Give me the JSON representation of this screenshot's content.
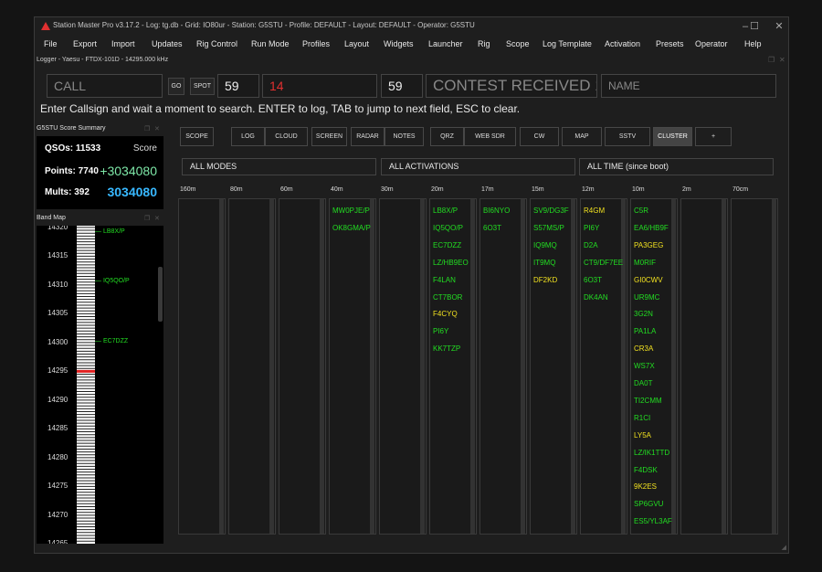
{
  "titlebar": {
    "title": "Station Master Pro v3.17.2 - Log: tg.db - Grid: IO80ur - Station: G5STU - Profile: DEFAULT - Layout: DEFAULT - Operator: G5STU",
    "logo_icon": "triangle-logo-icon",
    "minimize": "–",
    "maximize": "☐",
    "close": "✕"
  },
  "menu": [
    "File",
    "Export",
    "Import",
    "Updates",
    "Rig Control",
    "Run Mode",
    "Profiles",
    "Layout",
    "Widgets",
    "Launcher",
    "Rig",
    "Scope",
    "Log Template",
    "Activation",
    "Presets",
    "Operator",
    "Help"
  ],
  "logger": {
    "title": "Logger - Yaesu - FTDX-101D - 14295.000 kHz",
    "call_placeholder": "CALL",
    "go_label": "GO",
    "spot_label": "SPOT",
    "rst_sent": "59",
    "sent_serial": "14",
    "rst_rcvd": "59",
    "contest_placeholder": "CONTEST RECEIVED 1",
    "name_placeholder": "NAME",
    "hint": "Enter Callsign and wait a moment to search. ENTER to log, TAB to jump to next field, ESC to clear."
  },
  "score": {
    "header": "G5STU Score Summary",
    "qsos_label": "QSOs: 11533",
    "score_label": "Score",
    "points_label": "Points: 7740",
    "points_value": "+3034080",
    "mults_label": "Mults: 392",
    "mults_value": "3034080",
    "points_color": "#7ee8a8",
    "mults_color": "#38b8ff"
  },
  "bandmap": {
    "header": "Band Map",
    "freqs": [
      "14320",
      "14315",
      "14310",
      "14305",
      "14300",
      "14295",
      "14290",
      "14285",
      "14280",
      "14275",
      "14270",
      "14265"
    ],
    "spots": [
      {
        "label": "LB8X/P"
      },
      {
        "label": "IQ5QO/P"
      },
      {
        "label": "EC7DZZ"
      }
    ],
    "current_freq_color": "#e02020"
  },
  "cluster": {
    "tabs": [
      "SCOPE",
      "LOG",
      "CLOUD",
      "SCREEN",
      "RADAR",
      "NOTES",
      "QRZ",
      "WEB SDR",
      "CW",
      "MAP",
      "SSTV",
      "CLUSTER",
      "+"
    ],
    "active_tab": "CLUSTER",
    "filters": {
      "mode": "ALL MODES",
      "activation": "ALL ACTIVATIONS",
      "time": "ALL TIME (since boot)"
    },
    "bands": [
      {
        "label": "160m",
        "spots": []
      },
      {
        "label": "80m",
        "spots": []
      },
      {
        "label": "60m",
        "spots": []
      },
      {
        "label": "40m",
        "spots": [
          {
            "call": "MW0PJE/P",
            "color": "#22dd22"
          },
          {
            "call": "OK8GMA/P",
            "color": "#22dd22"
          }
        ]
      },
      {
        "label": "30m",
        "spots": []
      },
      {
        "label": "20m",
        "spots": [
          {
            "call": "LB8X/P",
            "color": "#22dd22"
          },
          {
            "call": "IQ5QO/P",
            "color": "#22dd22"
          },
          {
            "call": "EC7DZZ",
            "color": "#22dd22"
          },
          {
            "call": "LZ/HB9EO",
            "color": "#22dd22"
          },
          {
            "call": "F4LAN",
            "color": "#22dd22"
          },
          {
            "call": "CT7BOR",
            "color": "#22dd22"
          },
          {
            "call": "F4CYQ",
            "color": "#f0e020"
          },
          {
            "call": "PI6Y",
            "color": "#22dd22"
          },
          {
            "call": "KK7TZP",
            "color": "#22dd22"
          }
        ]
      },
      {
        "label": "17m",
        "spots": [
          {
            "call": "BI6NYO",
            "color": "#22dd22"
          },
          {
            "call": "6O3T",
            "color": "#22dd22"
          }
        ]
      },
      {
        "label": "15m",
        "spots": [
          {
            "call": "SV9/DG3F",
            "color": "#22dd22"
          },
          {
            "call": "S57MS/P",
            "color": "#22dd22"
          },
          {
            "call": "IQ9MQ",
            "color": "#22dd22"
          },
          {
            "call": "IT9MQ",
            "color": "#22dd22"
          },
          {
            "call": "DF2KD",
            "color": "#f0e020"
          }
        ]
      },
      {
        "label": "12m",
        "spots": [
          {
            "call": "R4GM",
            "color": "#f0e020"
          },
          {
            "call": "PI6Y",
            "color": "#22dd22"
          },
          {
            "call": "D2A",
            "color": "#22dd22"
          },
          {
            "call": "CT9/DF7EE",
            "color": "#22dd22"
          },
          {
            "call": "6O3T",
            "color": "#22dd22"
          },
          {
            "call": "DK4AN",
            "color": "#22dd22"
          }
        ]
      },
      {
        "label": "10m",
        "spots": [
          {
            "call": "C5R",
            "color": "#22dd22"
          },
          {
            "call": "EA6/HB9F",
            "color": "#22dd22"
          },
          {
            "call": "PA3GEG",
            "color": "#f0e020"
          },
          {
            "call": "M0RIF",
            "color": "#22dd22"
          },
          {
            "call": "GI0CWV",
            "color": "#f0e020"
          },
          {
            "call": "UR9MC",
            "color": "#22dd22"
          },
          {
            "call": "3G2N",
            "color": "#22dd22"
          },
          {
            "call": "PA1LA",
            "color": "#22dd22"
          },
          {
            "call": "CR3A",
            "color": "#f0e020"
          },
          {
            "call": "WS7X",
            "color": "#22dd22"
          },
          {
            "call": "DA0T",
            "color": "#22dd22"
          },
          {
            "call": "TI2CMM",
            "color": "#22dd22"
          },
          {
            "call": "R1CI",
            "color": "#22dd22"
          },
          {
            "call": "LY5A",
            "color": "#f0e020"
          },
          {
            "call": "LZ/IK1TTD",
            "color": "#22dd22"
          },
          {
            "call": "F4DSK",
            "color": "#22dd22"
          },
          {
            "call": "9K2ES",
            "color": "#f0e020"
          },
          {
            "call": "SP6GVU",
            "color": "#22dd22"
          },
          {
            "call": "ES5/YL3AF",
            "color": "#22dd22"
          }
        ]
      },
      {
        "label": "2m",
        "spots": []
      },
      {
        "label": "70cm",
        "spots": []
      }
    ]
  }
}
